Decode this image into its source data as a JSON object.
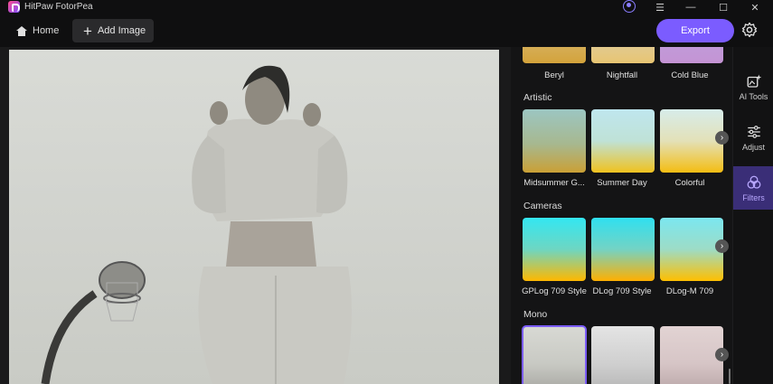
{
  "app": {
    "title": "HitPaw FotorPea"
  },
  "toolbar": {
    "home_label": "Home",
    "add_image_label": "Add Image",
    "export_label": "Export"
  },
  "rail": [
    {
      "label": "AI Tools",
      "icon": "ai-tools-icon",
      "active": false
    },
    {
      "label": "Adjust",
      "icon": "adjust-sliders-icon",
      "active": false
    },
    {
      "label": "Filters",
      "icon": "filters-icon",
      "active": true
    }
  ],
  "filters": {
    "top_row": [
      "Beryl",
      "Nightfall",
      "Cold Blue"
    ],
    "sections": [
      {
        "title": "Artistic",
        "items": [
          "Midsummer G...",
          "Summer Day",
          "Colorful"
        ]
      },
      {
        "title": "Cameras",
        "items": [
          "GPLog 709 Style",
          "DLog 709 Style",
          "DLog-M 709"
        ]
      },
      {
        "title": "Mono",
        "items": [
          "",
          "",
          ""
        ]
      }
    ]
  },
  "colors": {
    "accent": "#7b5cff",
    "panel": "#141415",
    "background": "#0f0f10"
  }
}
